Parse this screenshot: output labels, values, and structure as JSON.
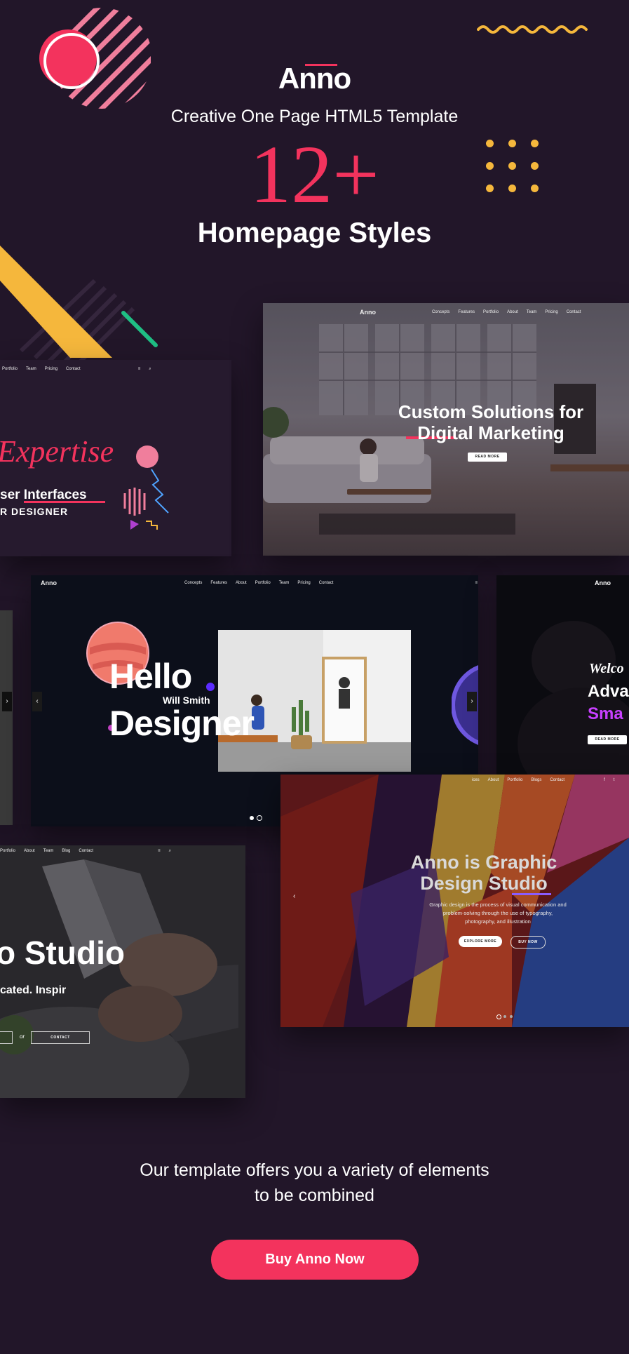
{
  "header": {
    "logo": "Anno",
    "tagline": "Creative One Page HTML5 Template",
    "count": "12+",
    "subtitle": "Homepage Styles"
  },
  "previews": {
    "p1": {
      "nav": [
        "Portfolio",
        "Team",
        "Pricing",
        "Contact"
      ],
      "script": "Expertise",
      "line1": "ser Interfaces",
      "line2": "R DESIGNER"
    },
    "p2": {
      "logo": "Anno",
      "nav": [
        "Concepts",
        "Features",
        "Portfolio",
        "About",
        "Team",
        "Pricing",
        "Contact"
      ],
      "title1": "Custom Solutions for",
      "title2": "Digital Marketing",
      "button": "READ MORE"
    },
    "p3": {
      "logo": "Anno",
      "nav": [
        "Concepts",
        "Features",
        "About",
        "Portfolio",
        "Team",
        "Pricing",
        "Contact"
      ],
      "hello": "Hello",
      "name": "Will Smith",
      "designer": "Designer"
    },
    "p4": {
      "logo": "Anno",
      "script": "Welco",
      "line1": "Adva",
      "line2": "Sma",
      "button": "READ MORE"
    },
    "p5": {
      "nav": [
        "Portfolio",
        "About",
        "Team",
        "Blog",
        "Contact"
      ],
      "title": "o Studio",
      "sub": "cated. Inspir",
      "or": "or",
      "contact": "CONTACT"
    },
    "p6": {
      "nav": [
        "ices",
        "About",
        "Portfolio",
        "Blogs",
        "Contact"
      ],
      "title1": "Anno is Graphic",
      "title2": "Design Studio",
      "desc": "Graphic design is the process of visual communication and problem-solving through the use of typography, photography, and illustration",
      "btn1": "EXPLORE MORE",
      "btn2": "BUY NOW"
    }
  },
  "footer": {
    "text_line1": "Our template offers you a variety of elements",
    "text_line2": "to be combined",
    "cta": "Buy Anno Now"
  },
  "colors": {
    "background": "#221629",
    "accent": "#f3335d",
    "yellow": "#f5b73c",
    "green": "#1fbf84"
  }
}
